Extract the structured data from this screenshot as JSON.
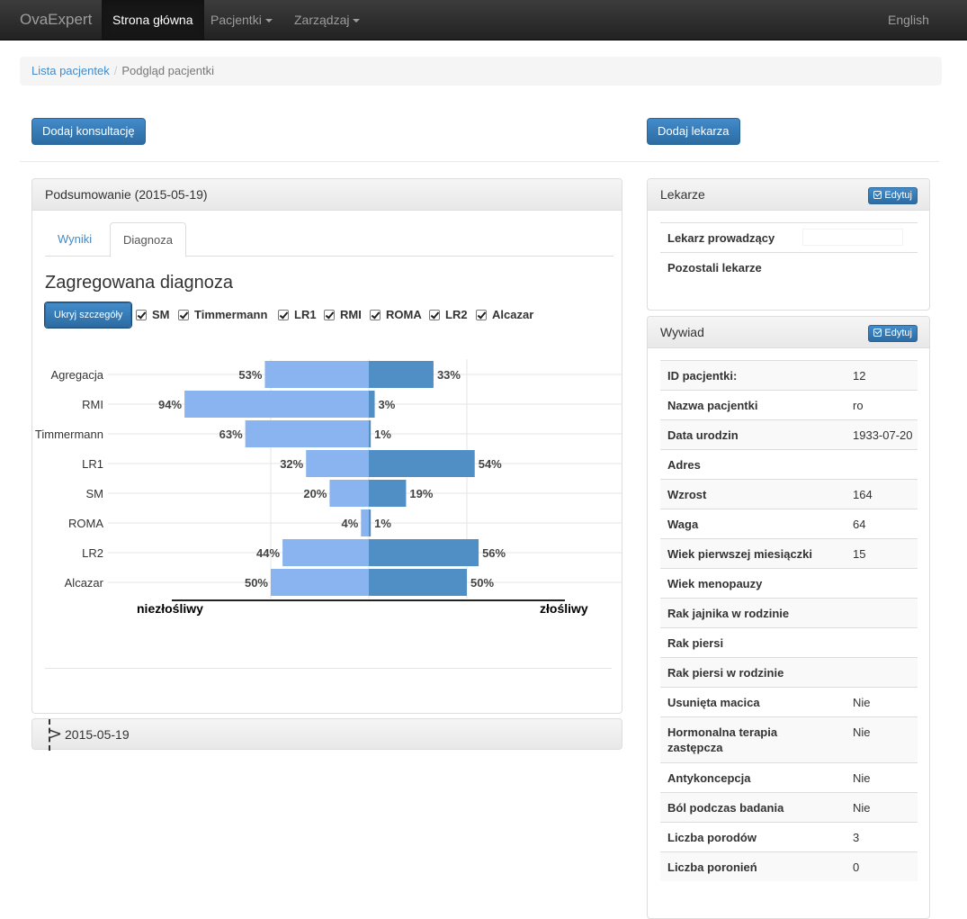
{
  "navbar": {
    "brand": "OvaExpert",
    "items": [
      {
        "label": "Strona główna"
      },
      {
        "label": "Pacjentki"
      },
      {
        "label": "Zarządzaj"
      }
    ],
    "language": "English"
  },
  "breadcrumb": {
    "link": "Lista pacjentek",
    "separator": "/",
    "current": "Podgląd pacjentki"
  },
  "buttons": {
    "add_consultation": "Dodaj konsultację",
    "add_doctor": "Dodaj lekarza"
  },
  "summary": {
    "heading": "Podsumowanie (2015-05-19)",
    "tabs": [
      {
        "label": "Wyniki"
      },
      {
        "label": "Diagnoza"
      }
    ],
    "title": "Zagregowana diagnoza",
    "toggle_label": "Ukryj szczegóły",
    "checkboxes": [
      {
        "label": "SM",
        "checked": true
      },
      {
        "label": "Timmermann",
        "checked": true
      },
      {
        "label": "LR1",
        "checked": true
      },
      {
        "label": "RMI",
        "checked": true
      },
      {
        "label": "ROMA",
        "checked": true
      },
      {
        "label": "LR2",
        "checked": true
      },
      {
        "label": "Alcazar",
        "checked": true
      }
    ]
  },
  "chart_data": {
    "type": "bar",
    "orientation": "diverging-horizontal",
    "categories": [
      "Agregacja",
      "RMI",
      "Timmermann",
      "LR1",
      "SM",
      "ROMA",
      "LR2",
      "Alcazar"
    ],
    "series": [
      {
        "name": "niezłośliwy",
        "values": [
          53,
          94,
          63,
          32,
          20,
          4,
          44,
          50
        ],
        "labels": [
          "53%",
          "94%",
          "63%",
          "32%",
          "20%",
          "4%",
          "44%",
          "50%"
        ],
        "color": "#8ab4f0"
      },
      {
        "name": "złośliwy",
        "values": [
          33,
          3,
          1,
          54,
          19,
          1,
          56,
          50
        ],
        "labels": [
          "33%",
          "3%",
          "1%",
          "54%",
          "19%",
          "1%",
          "56%",
          "50%"
        ],
        "color": "#4f8fc5"
      }
    ],
    "axis_left_label": "niezłośliwy",
    "axis_right_label": "złośliwy",
    "xlim": [
      -100,
      100
    ],
    "grid": true
  },
  "history_item": {
    "label": "2015-05-19"
  },
  "doctors_panel": {
    "heading": "Lekarze",
    "edit_label": "Edytuj",
    "rows": [
      {
        "key": "Lekarz prowadzący",
        "value": ""
      },
      {
        "key": "Pozostali lekarze",
        "value": ""
      }
    ]
  },
  "interview_panel": {
    "heading": "Wywiad",
    "edit_label": "Edytuj",
    "rows": [
      {
        "key": "ID pacjentki:",
        "value": "12"
      },
      {
        "key": "Nazwa pacjentki",
        "value": "ro"
      },
      {
        "key": "Data urodzin",
        "value": "1933-07-20"
      },
      {
        "key": "Adres",
        "value": ""
      },
      {
        "key": "Wzrost",
        "value": "164"
      },
      {
        "key": "Waga",
        "value": "64"
      },
      {
        "key": "Wiek pierwszej miesiączki",
        "value": "15"
      },
      {
        "key": "Wiek menopauzy",
        "value": ""
      },
      {
        "key": "Rak jajnika w rodzinie",
        "value": ""
      },
      {
        "key": "Rak piersi",
        "value": ""
      },
      {
        "key": "Rak piersi w rodzinie",
        "value": ""
      },
      {
        "key": "Usunięta macica",
        "value": "Nie"
      },
      {
        "key": "Hormonalna terapia zastępcza",
        "value": "Nie"
      },
      {
        "key": "Antykoncepcja",
        "value": "Nie"
      },
      {
        "key": "Ból podczas badania",
        "value": "Nie"
      },
      {
        "key": "Liczba porodów",
        "value": "3"
      },
      {
        "key": "Liczba poronień",
        "value": "0"
      }
    ]
  }
}
